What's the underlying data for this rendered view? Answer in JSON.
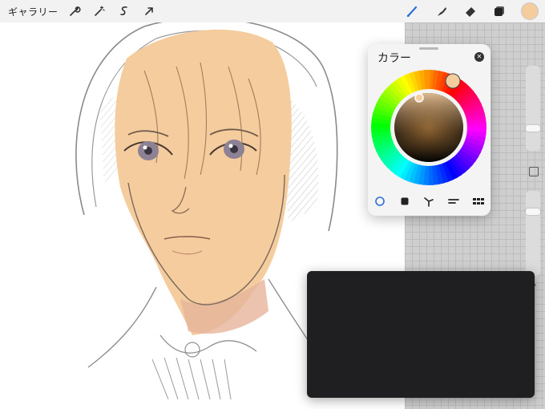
{
  "toolbar": {
    "gallery_label": "ギャラリー",
    "left_icons": [
      "wrench-icon",
      "magic-wand-icon",
      "selection-icon",
      "transform-arrow-icon"
    ],
    "right_icons": [
      "brush-icon",
      "smudge-icon",
      "eraser-icon",
      "layers-icon"
    ],
    "active_tool": "brush-icon",
    "current_color": "#f4cc9e",
    "accent": "#2f6fd8"
  },
  "color_panel": {
    "title": "カラー",
    "close_icon": "close-icon",
    "mode_tabs": [
      "disc-icon",
      "classic-icon",
      "harmony-icon",
      "value-icon",
      "palettes-icon"
    ],
    "active_tab": "disc-icon"
  },
  "canvas": {
    "skin_color": "#f4cc9e",
    "sketch_color": "#7d7d7d",
    "dark_panel_color": "#1f1f22"
  }
}
